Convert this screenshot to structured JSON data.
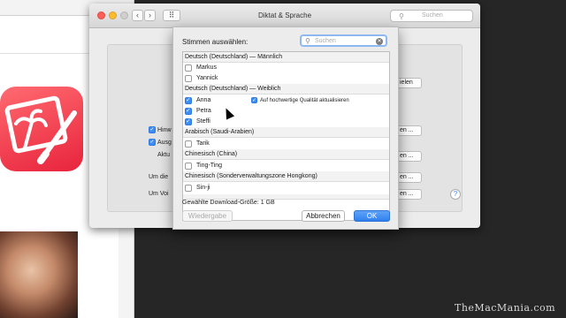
{
  "preferences_window": {
    "title": "Diktat & Sprache",
    "search_placeholder": "Suchen",
    "partial_labels": [
      "Hinw",
      "Ausg",
      "Aktu",
      "Um die",
      "Um Voi"
    ],
    "partial_buttons": [
      "ielen",
      "en ...",
      "en ...",
      "en ...",
      "en ..."
    ]
  },
  "voice_sheet": {
    "heading": "Stimmen auswählen:",
    "search_placeholder": "Suchen",
    "groups": [
      {
        "label": "Deutsch (Deutschland) — Männlich",
        "voices": [
          {
            "name": "Markus",
            "checked": false
          },
          {
            "name": "Yannick",
            "checked": false
          }
        ]
      },
      {
        "label": "Deutsch (Deutschland) — Weiblich",
        "voices": [
          {
            "name": "Anna",
            "checked": true
          },
          {
            "name": "Petra",
            "checked": true
          },
          {
            "name": "Steffi",
            "checked": true
          }
        ]
      },
      {
        "label": "Arabisch (Saudi-Arabien)",
        "voices": [
          {
            "name": "Tarik",
            "checked": false
          }
        ]
      },
      {
        "label": "Chinesisch (China)",
        "voices": [
          {
            "name": "Ting-Ting",
            "checked": false
          }
        ]
      },
      {
        "label": "Chinesisch (Sonderverwaltungszone Hongkong)",
        "voices": [
          {
            "name": "Sin-ji",
            "checked": false
          }
        ]
      }
    ],
    "hq_option": "Auf hochwertige Qualität aktualisieren",
    "download_size": "Gewählte Download-Größe: 1 GB",
    "buttons": {
      "preview": "Wiedergabe",
      "cancel": "Abbrechen",
      "ok": "OK"
    }
  },
  "watermark": "TheMacMania.com",
  "colors": {
    "accent": "#3d8df5",
    "ok_button": "#2f80ee",
    "app_icon": "#e8243c"
  }
}
